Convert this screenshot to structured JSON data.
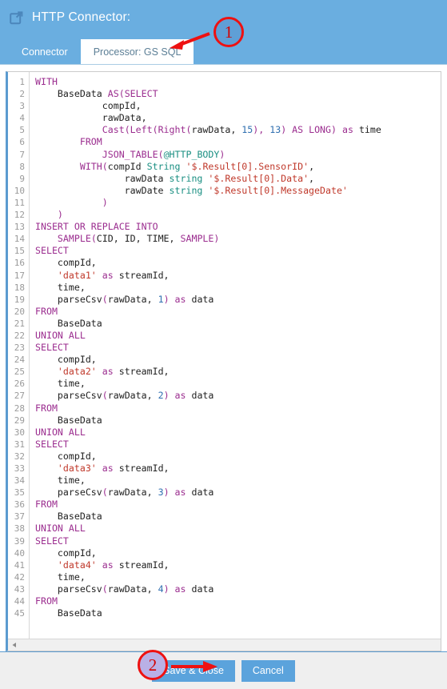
{
  "window": {
    "icon": "external-link-icon",
    "title": "HTTP Connector:"
  },
  "tabs": [
    {
      "label": "Connector",
      "active": false
    },
    {
      "label": "Processor: GS SQL",
      "active": true
    }
  ],
  "editor": {
    "language": "GS SQL",
    "first_line": 1,
    "line_count": 45,
    "scrollbar": {
      "orientation": "horizontal",
      "left_arrow": "triangle-left-icon"
    },
    "lines": [
      {
        "n": 1,
        "tokens": [
          {
            "t": "WITH",
            "c": "k"
          }
        ]
      },
      {
        "n": 2,
        "tokens": [
          {
            "t": "    BaseData ",
            "c": "d"
          },
          {
            "t": "AS",
            "c": "k"
          },
          {
            "t": "(",
            "c": "p"
          },
          {
            "t": "SELECT",
            "c": "k"
          }
        ]
      },
      {
        "n": 3,
        "tokens": [
          {
            "t": "            compId,",
            "c": "d"
          }
        ]
      },
      {
        "n": 4,
        "tokens": [
          {
            "t": "            rawData,",
            "c": "d"
          }
        ]
      },
      {
        "n": 5,
        "tokens": [
          {
            "t": "            ",
            "c": "d"
          },
          {
            "t": "Cast",
            "c": "k"
          },
          {
            "t": "(",
            "c": "p"
          },
          {
            "t": "Left",
            "c": "k"
          },
          {
            "t": "(",
            "c": "p"
          },
          {
            "t": "Right",
            "c": "k"
          },
          {
            "t": "(",
            "c": "p"
          },
          {
            "t": "rawData, ",
            "c": "d"
          },
          {
            "t": "15",
            "c": "n"
          },
          {
            "t": "), ",
            "c": "p"
          },
          {
            "t": "13",
            "c": "n"
          },
          {
            "t": ") ",
            "c": "p"
          },
          {
            "t": "AS LONG",
            "c": "k"
          },
          {
            "t": ")",
            "c": "p"
          },
          {
            "t": " as ",
            "c": "k"
          },
          {
            "t": "time",
            "c": "d"
          }
        ]
      },
      {
        "n": 6,
        "tokens": [
          {
            "t": "        ",
            "c": "d"
          },
          {
            "t": "FROM",
            "c": "k"
          }
        ]
      },
      {
        "n": 7,
        "tokens": [
          {
            "t": "            ",
            "c": "d"
          },
          {
            "t": "JSON_TABLE",
            "c": "k"
          },
          {
            "t": "(",
            "c": "p"
          },
          {
            "t": "@HTTP_BODY",
            "c": "t"
          },
          {
            "t": ")",
            "c": "p"
          }
        ]
      },
      {
        "n": 8,
        "tokens": [
          {
            "t": "        ",
            "c": "d"
          },
          {
            "t": "WITH",
            "c": "k"
          },
          {
            "t": "(",
            "c": "p"
          },
          {
            "t": "compId ",
            "c": "d"
          },
          {
            "t": "String",
            "c": "t"
          },
          {
            "t": " ",
            "c": "d"
          },
          {
            "t": "'$.Result[0].SensorID'",
            "c": "s"
          },
          {
            "t": ",",
            "c": "d"
          }
        ]
      },
      {
        "n": 9,
        "tokens": [
          {
            "t": "                rawData ",
            "c": "d"
          },
          {
            "t": "string",
            "c": "t"
          },
          {
            "t": " ",
            "c": "d"
          },
          {
            "t": "'$.Result[0].Data'",
            "c": "s"
          },
          {
            "t": ",",
            "c": "d"
          }
        ]
      },
      {
        "n": 10,
        "tokens": [
          {
            "t": "                rawDate ",
            "c": "d"
          },
          {
            "t": "string",
            "c": "t"
          },
          {
            "t": " ",
            "c": "d"
          },
          {
            "t": "'$.Result[0].MessageDate'",
            "c": "s"
          }
        ]
      },
      {
        "n": 11,
        "tokens": [
          {
            "t": "            ",
            "c": "d"
          },
          {
            "t": ")",
            "c": "p"
          }
        ]
      },
      {
        "n": 12,
        "tokens": [
          {
            "t": "    ",
            "c": "d"
          },
          {
            "t": ")",
            "c": "p"
          }
        ]
      },
      {
        "n": 13,
        "tokens": [
          {
            "t": "INSERT OR REPLACE INTO",
            "c": "k"
          }
        ]
      },
      {
        "n": 14,
        "tokens": [
          {
            "t": "    ",
            "c": "d"
          },
          {
            "t": "SAMPLE",
            "c": "k"
          },
          {
            "t": "(",
            "c": "p"
          },
          {
            "t": "CID, ID, TIME, ",
            "c": "d"
          },
          {
            "t": "SAMPLE",
            "c": "k"
          },
          {
            "t": ")",
            "c": "p"
          }
        ]
      },
      {
        "n": 15,
        "tokens": [
          {
            "t": "SELECT",
            "c": "k"
          }
        ]
      },
      {
        "n": 16,
        "tokens": [
          {
            "t": "    compId,",
            "c": "d"
          }
        ]
      },
      {
        "n": 17,
        "tokens": [
          {
            "t": "    ",
            "c": "d"
          },
          {
            "t": "'data1'",
            "c": "s"
          },
          {
            "t": " as ",
            "c": "k"
          },
          {
            "t": "streamId,",
            "c": "d"
          }
        ]
      },
      {
        "n": 18,
        "tokens": [
          {
            "t": "    time,",
            "c": "d"
          }
        ]
      },
      {
        "n": 19,
        "tokens": [
          {
            "t": "    parseCsv",
            "c": "d"
          },
          {
            "t": "(",
            "c": "p"
          },
          {
            "t": "rawData, ",
            "c": "d"
          },
          {
            "t": "1",
            "c": "n"
          },
          {
            "t": ")",
            "c": "p"
          },
          {
            "t": " as ",
            "c": "k"
          },
          {
            "t": "data",
            "c": "d"
          }
        ]
      },
      {
        "n": 20,
        "tokens": [
          {
            "t": "FROM",
            "c": "k"
          }
        ]
      },
      {
        "n": 21,
        "tokens": [
          {
            "t": "    BaseData",
            "c": "d"
          }
        ]
      },
      {
        "n": 22,
        "tokens": [
          {
            "t": "UNION ALL",
            "c": "k"
          }
        ]
      },
      {
        "n": 23,
        "tokens": [
          {
            "t": "SELECT",
            "c": "k"
          }
        ]
      },
      {
        "n": 24,
        "tokens": [
          {
            "t": "    compId,",
            "c": "d"
          }
        ]
      },
      {
        "n": 25,
        "tokens": [
          {
            "t": "    ",
            "c": "d"
          },
          {
            "t": "'data2'",
            "c": "s"
          },
          {
            "t": " as ",
            "c": "k"
          },
          {
            "t": "streamId,",
            "c": "d"
          }
        ]
      },
      {
        "n": 26,
        "tokens": [
          {
            "t": "    time,",
            "c": "d"
          }
        ]
      },
      {
        "n": 27,
        "tokens": [
          {
            "t": "    parseCsv",
            "c": "d"
          },
          {
            "t": "(",
            "c": "p"
          },
          {
            "t": "rawData, ",
            "c": "d"
          },
          {
            "t": "2",
            "c": "n"
          },
          {
            "t": ")",
            "c": "p"
          },
          {
            "t": " as ",
            "c": "k"
          },
          {
            "t": "data",
            "c": "d"
          }
        ]
      },
      {
        "n": 28,
        "tokens": [
          {
            "t": "FROM",
            "c": "k"
          }
        ]
      },
      {
        "n": 29,
        "tokens": [
          {
            "t": "    BaseData",
            "c": "d"
          }
        ]
      },
      {
        "n": 30,
        "tokens": [
          {
            "t": "UNION ALL",
            "c": "k"
          }
        ]
      },
      {
        "n": 31,
        "tokens": [
          {
            "t": "SELECT",
            "c": "k"
          }
        ]
      },
      {
        "n": 32,
        "tokens": [
          {
            "t": "    compId,",
            "c": "d"
          }
        ]
      },
      {
        "n": 33,
        "tokens": [
          {
            "t": "    ",
            "c": "d"
          },
          {
            "t": "'data3'",
            "c": "s"
          },
          {
            "t": " as ",
            "c": "k"
          },
          {
            "t": "streamId,",
            "c": "d"
          }
        ]
      },
      {
        "n": 34,
        "tokens": [
          {
            "t": "    time,",
            "c": "d"
          }
        ]
      },
      {
        "n": 35,
        "tokens": [
          {
            "t": "    parseCsv",
            "c": "d"
          },
          {
            "t": "(",
            "c": "p"
          },
          {
            "t": "rawData, ",
            "c": "d"
          },
          {
            "t": "3",
            "c": "n"
          },
          {
            "t": ")",
            "c": "p"
          },
          {
            "t": " as ",
            "c": "k"
          },
          {
            "t": "data",
            "c": "d"
          }
        ]
      },
      {
        "n": 36,
        "tokens": [
          {
            "t": "FROM",
            "c": "k"
          }
        ]
      },
      {
        "n": 37,
        "tokens": [
          {
            "t": "    BaseData",
            "c": "d"
          }
        ]
      },
      {
        "n": 38,
        "tokens": [
          {
            "t": "UNION ALL",
            "c": "k"
          }
        ]
      },
      {
        "n": 39,
        "tokens": [
          {
            "t": "SELECT",
            "c": "k"
          }
        ]
      },
      {
        "n": 40,
        "tokens": [
          {
            "t": "    compId,",
            "c": "d"
          }
        ]
      },
      {
        "n": 41,
        "tokens": [
          {
            "t": "    ",
            "c": "d"
          },
          {
            "t": "'data4'",
            "c": "s"
          },
          {
            "t": " as ",
            "c": "k"
          },
          {
            "t": "streamId,",
            "c": "d"
          }
        ]
      },
      {
        "n": 42,
        "tokens": [
          {
            "t": "    time,",
            "c": "d"
          }
        ]
      },
      {
        "n": 43,
        "tokens": [
          {
            "t": "    parseCsv",
            "c": "d"
          },
          {
            "t": "(",
            "c": "p"
          },
          {
            "t": "rawData, ",
            "c": "d"
          },
          {
            "t": "4",
            "c": "n"
          },
          {
            "t": ")",
            "c": "p"
          },
          {
            "t": " as ",
            "c": "k"
          },
          {
            "t": "data",
            "c": "d"
          }
        ]
      },
      {
        "n": 44,
        "tokens": [
          {
            "t": "FROM",
            "c": "k"
          }
        ]
      },
      {
        "n": 45,
        "tokens": [
          {
            "t": "    BaseData",
            "c": "d"
          }
        ]
      }
    ]
  },
  "footer": {
    "save_label": "Save & Close",
    "cancel_label": "Cancel"
  },
  "annotations": [
    {
      "number": "1",
      "target": "processor-gs-sql-tab"
    },
    {
      "number": "2",
      "target": "save-and-close-button"
    }
  ],
  "colors": {
    "header_blue": "#6aaee0",
    "button_blue": "#5ba3dc",
    "annotation_red": "#ee1111",
    "keyword_purple": "#9b2d8f",
    "string_red": "#c0392b",
    "type_teal": "#1a8f82"
  }
}
